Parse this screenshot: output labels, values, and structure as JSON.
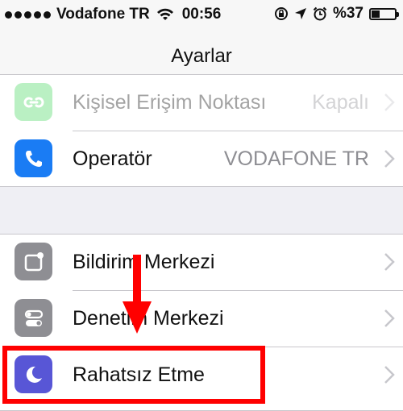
{
  "status_bar": {
    "carrier": "Vodafone TR",
    "time": "00:56",
    "battery_percent": "%37",
    "battery_level": 0.37,
    "icons": [
      "signal-dots",
      "wifi-icon",
      "rotation-lock-icon",
      "location-arrow-icon",
      "alarm-clock-icon",
      "battery-icon"
    ]
  },
  "nav": {
    "title": "Ayarlar"
  },
  "rows": {
    "hotspot": {
      "label": "Kişisel Erişim Noktası",
      "value": "Kapalı",
      "icon": "hotspot-icon",
      "icon_color": "#4cd964"
    },
    "carrier": {
      "label": "Operatör",
      "value": "VODAFONE TR",
      "icon": "phone-icon",
      "icon_color": "#1a7cf4"
    },
    "notifications": {
      "label": "Bildirim Merkezi",
      "icon": "notification-center-icon",
      "icon_color": "#8e8e93"
    },
    "control_center": {
      "label": "Denetim Merkezi",
      "icon": "control-center-icon",
      "icon_color": "#8e8e93"
    },
    "do_not_disturb": {
      "label": "Rahatsız Etme",
      "icon": "moon-icon",
      "icon_color": "#5856d6"
    }
  },
  "annotation": {
    "color": "#ff0000",
    "arrow_target": "do_not_disturb"
  }
}
